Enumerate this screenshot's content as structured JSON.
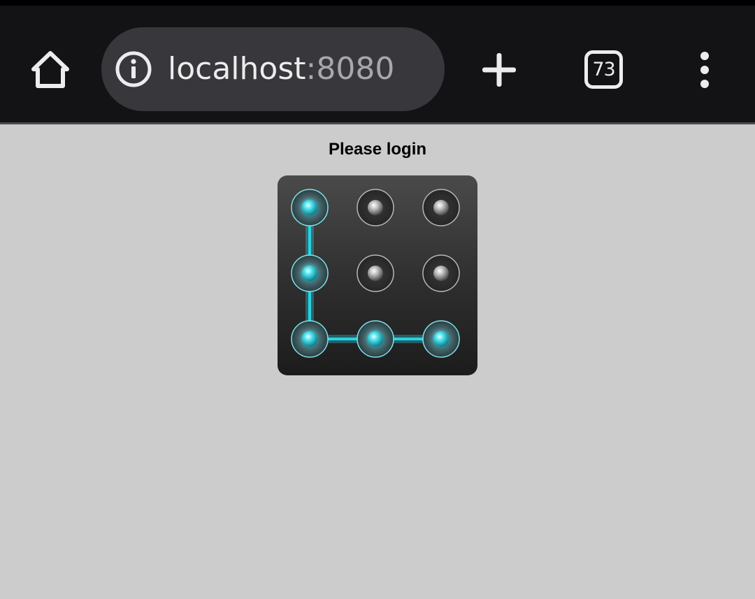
{
  "browser": {
    "url_host": "localhost",
    "url_port": ":8080",
    "tab_count": "73",
    "icons": {
      "home": "home-icon",
      "site_info": "info-icon",
      "new_tab": "plus-icon",
      "tabs": "tab-switcher-icon",
      "menu": "more-vert-icon"
    }
  },
  "page": {
    "title": "Please login"
  },
  "pattern_lock": {
    "grid_size": 3,
    "selected_path": [
      0,
      3,
      6,
      7,
      8
    ],
    "colors": {
      "active": "#3fd9e6",
      "inactive": "#9a9a9a",
      "line": "#27d3e2",
      "background": "#333333"
    }
  },
  "colors": {
    "toolbar": "#131315",
    "url_bar": "#38383c",
    "page_background": "#cccccc"
  }
}
